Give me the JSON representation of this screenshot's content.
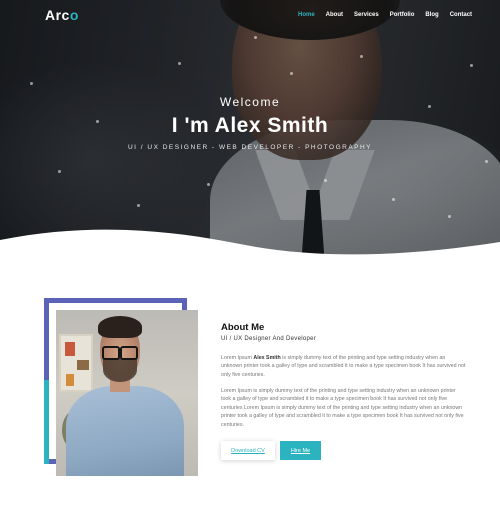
{
  "brand": {
    "logo_prefix": "Arc",
    "logo_accent": "o",
    "accent_color": "#2bb3c0",
    "frame_color": "#5a63b7"
  },
  "nav": {
    "items": [
      {
        "label": "Home",
        "active": true
      },
      {
        "label": "About",
        "active": false
      },
      {
        "label": "Services",
        "active": false
      },
      {
        "label": "Portfolio",
        "active": false
      },
      {
        "label": "Blog",
        "active": false
      },
      {
        "label": "Contact",
        "active": false
      }
    ]
  },
  "hero": {
    "welcome": "Welcome",
    "title": "I 'm Alex Smith",
    "subtitle": "UI / UX DESIGNER - WEB DEVELOPER - PHOTOGRAPHY"
  },
  "about": {
    "title": "About Me",
    "role": "UI / UX Designer And Developer",
    "p1_before": "Lorem Ipsum ",
    "p1_bold": "Alex Smith",
    "p1_after": " is simply dummy text of the printing and type setting industry when an unknown printer took a galley of type and scrambled it to make a type specimen book It has survived not only five centuries.",
    "p2": "Lorem Ipsum is simply dummy text of the printing and type setting industry when an unknown printer took a galley of type and scrambled it to make a type specimen book It has survived not only five centuries Lorem Ipsum is simply dummy text of the printing and type setting industry when an unknown printer took a galley of type and scrambled it to make a type specimen book It has survived not only five centuries.",
    "download_label": "Download CV",
    "hire_label": "Hire Me"
  }
}
